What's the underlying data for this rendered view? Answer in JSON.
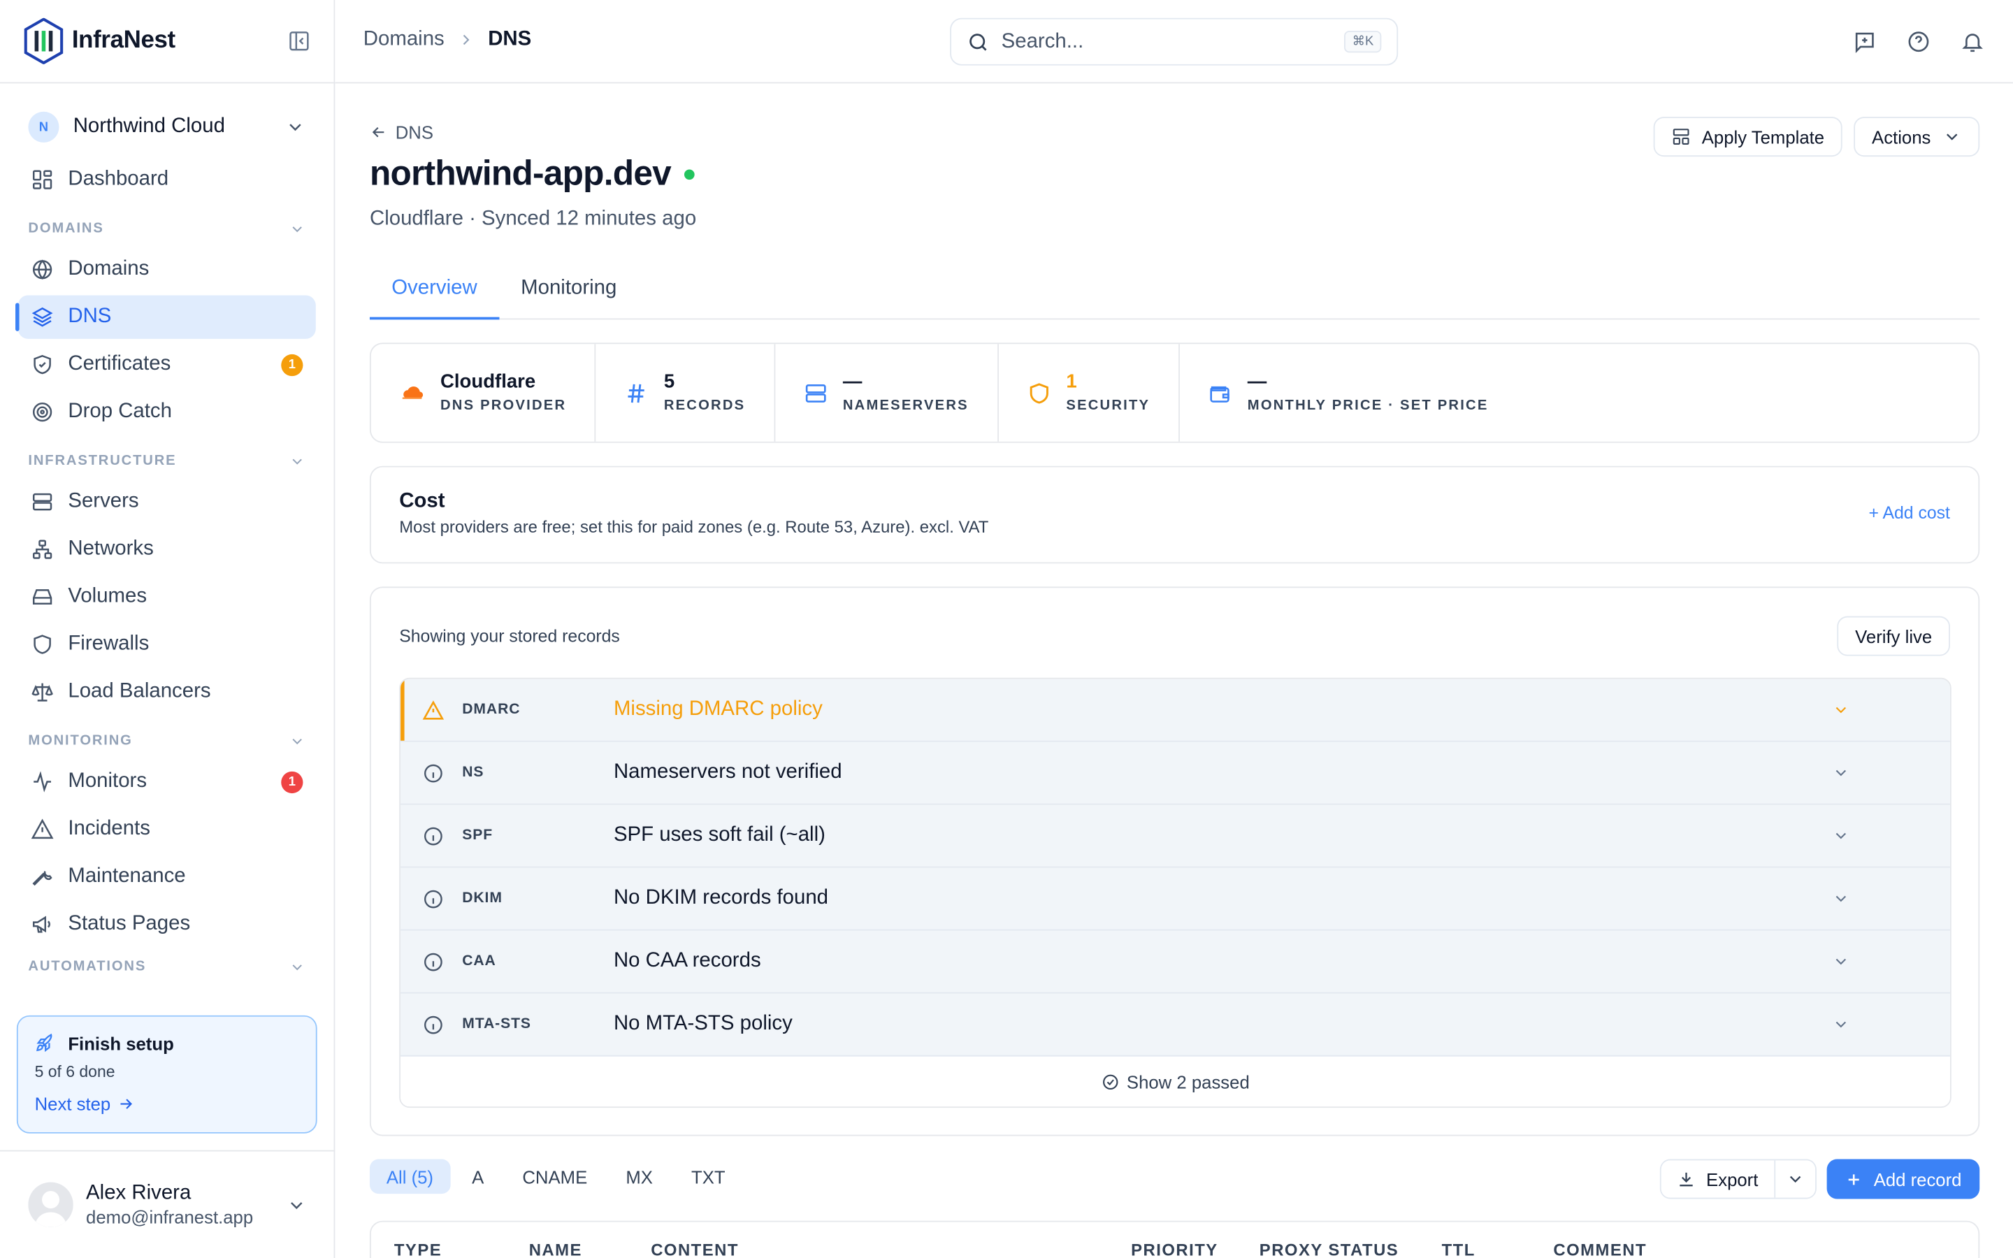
{
  "brand": {
    "name": "InfraNest"
  },
  "org": {
    "initial": "N",
    "name": "Northwind Cloud"
  },
  "nav": {
    "dashboard": "Dashboard",
    "sections": {
      "domains": "DOMAINS",
      "infrastructure": "INFRASTRUCTURE",
      "monitoring": "MONITORING",
      "automations": "AUTOMATIONS"
    },
    "domains_items": [
      {
        "label": "Domains",
        "icon": "globe-icon"
      },
      {
        "label": "DNS",
        "icon": "layers-icon",
        "active": true
      },
      {
        "label": "Certificates",
        "icon": "shield-check-icon",
        "badge": "1"
      },
      {
        "label": "Drop Catch",
        "icon": "target-icon"
      }
    ],
    "infrastructure_items": [
      {
        "label": "Servers",
        "icon": "server-icon"
      },
      {
        "label": "Networks",
        "icon": "network-icon"
      },
      {
        "label": "Volumes",
        "icon": "hard-drive-icon"
      },
      {
        "label": "Firewalls",
        "icon": "shield-icon"
      },
      {
        "label": "Load Balancers",
        "icon": "scale-icon"
      }
    ],
    "monitoring_items": [
      {
        "label": "Monitors",
        "icon": "activity-icon",
        "badge": "1"
      },
      {
        "label": "Incidents",
        "icon": "alert-triangle-icon"
      },
      {
        "label": "Maintenance",
        "icon": "wrench-icon"
      },
      {
        "label": "Status Pages",
        "icon": "megaphone-icon"
      }
    ]
  },
  "setup": {
    "title": "Finish setup",
    "progress": "5 of 6 done",
    "link": "Next step"
  },
  "user": {
    "name": "Alex Rivera",
    "email": "demo@infranest.app"
  },
  "topbar": {
    "breadcrumb": [
      "Domains",
      "DNS"
    ],
    "search_placeholder": "Search...",
    "search_shortcut": "⌘K"
  },
  "page": {
    "back_label": "DNS",
    "title": "northwind-app.dev",
    "status_color": "#22c55e",
    "subtitle": "Cloudflare · Synced 12 minutes ago",
    "apply_template": "Apply Template",
    "actions": "Actions",
    "tabs": [
      "Overview",
      "Monitoring"
    ]
  },
  "stats": [
    {
      "value": "Cloudflare",
      "label": "DNS PROVIDER",
      "icon": "cloud-icon",
      "color": "#f97316"
    },
    {
      "value": "5",
      "label": "RECORDS",
      "icon": "hash-icon",
      "color": "#3b82f6"
    },
    {
      "value": "—",
      "label": "NAMESERVERS",
      "icon": "server-icon",
      "color": "#3b82f6"
    },
    {
      "value": "1",
      "label": "SECURITY",
      "icon": "shield-icon",
      "color": "#f59e0b"
    },
    {
      "value": "—",
      "label": "MONTHLY PRICE · SET PRICE",
      "icon": "wallet-icon",
      "color": "#3b82f6"
    }
  ],
  "cost": {
    "title": "Cost",
    "subtitle": "Most providers are free; set this for paid zones (e.g. Route 53, Azure). excl. VAT",
    "link": "+ Add cost"
  },
  "checks": {
    "header": "Showing your stored records",
    "verify": "Verify live",
    "items": [
      {
        "tag": "DMARC",
        "message": "Missing DMARC policy",
        "level": "warning"
      },
      {
        "tag": "NS",
        "message": "Nameservers not verified",
        "level": "info"
      },
      {
        "tag": "SPF",
        "message": "SPF uses soft fail (~all)",
        "level": "info"
      },
      {
        "tag": "DKIM",
        "message": "No DKIM records found",
        "level": "info"
      },
      {
        "tag": "CAA",
        "message": "No CAA records",
        "level": "info"
      },
      {
        "tag": "MTA-STS",
        "message": "No MTA-STS policy",
        "level": "info"
      }
    ],
    "show_passed": "Show 2 passed"
  },
  "records": {
    "filters": [
      "All (5)",
      "A",
      "CNAME",
      "MX",
      "TXT"
    ],
    "export": "Export",
    "add": "Add record",
    "columns": [
      "TYPE",
      "NAME",
      "CONTENT",
      "PRIORITY",
      "PROXY STATUS",
      "TTL",
      "COMMENT"
    ]
  }
}
